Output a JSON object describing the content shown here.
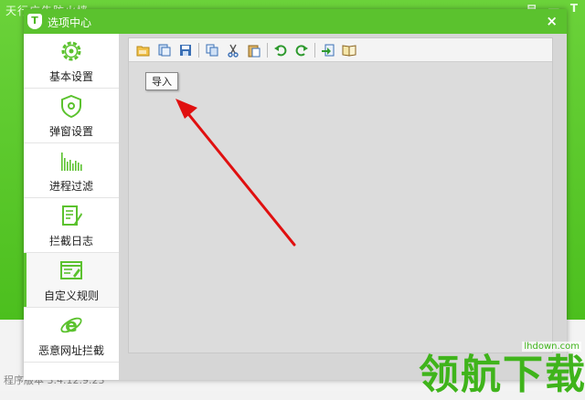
{
  "app": {
    "title": "天行广告防火墙",
    "version_text": "程序版本 3.4.12.9.23",
    "ctrls": [
      "目",
      "一",
      "T"
    ]
  },
  "dialog": {
    "title": "选项中心",
    "logo_text": "T",
    "close_label": "×"
  },
  "sidebar": {
    "items": [
      {
        "label": "基本设置",
        "icon": "gear-icon"
      },
      {
        "label": "弹窗设置",
        "icon": "shield-icon"
      },
      {
        "label": "进程过滤",
        "icon": "bars-icon"
      },
      {
        "label": "拦截日志",
        "icon": "log-icon"
      },
      {
        "label": "自定义规则",
        "icon": "rules-icon"
      },
      {
        "label": "恶意网址拦截",
        "icon": "ie-icon"
      }
    ],
    "active_index": 4
  },
  "toolbar": {
    "buttons": [
      "open-icon",
      "export-icon",
      "save-icon",
      "copy-icon",
      "cut-icon",
      "paste-icon",
      "undo-icon",
      "redo-icon",
      "import-icon",
      "help-icon"
    ],
    "tooltip": "导入"
  },
  "colors": {
    "accent": "#5bc22e",
    "arrow": "#e01010"
  },
  "watermark": {
    "text": "领航下载",
    "url": "lhdown.com"
  }
}
